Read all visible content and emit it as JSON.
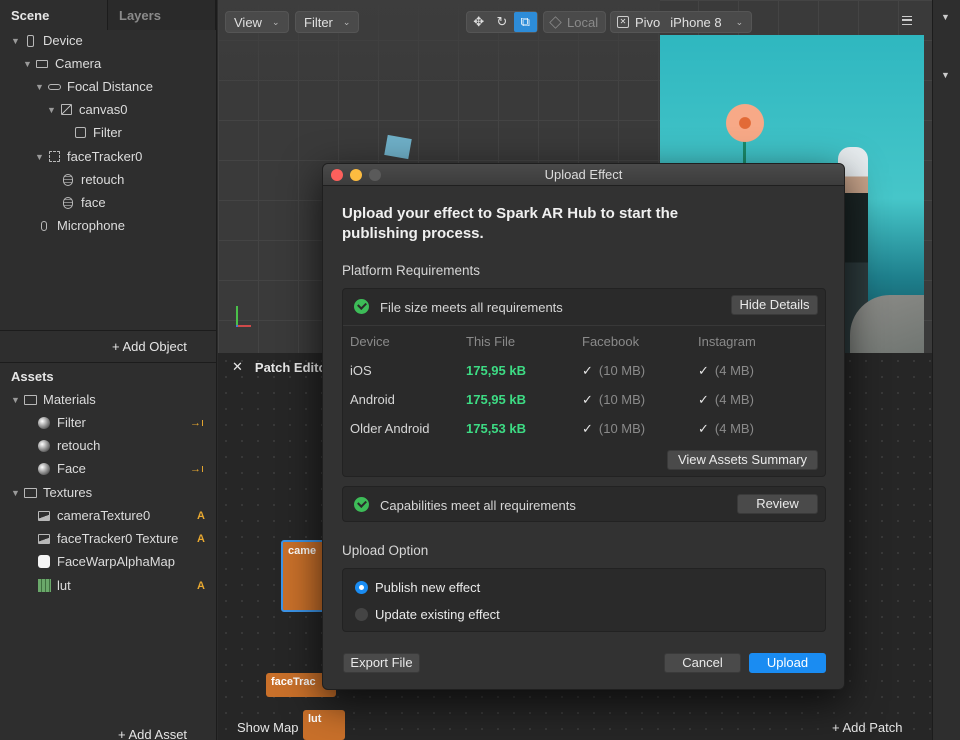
{
  "left_panel": {
    "tabs": [
      "Scene",
      "Layers"
    ],
    "scene_tree": {
      "device": "Device",
      "camera": "Camera",
      "focal_distance": "Focal Distance",
      "canvas": "canvas0",
      "filter": "Filter",
      "face_tracker": "faceTracker0",
      "retouch": "retouch",
      "face": "face",
      "microphone": "Microphone"
    },
    "add_object": "Add Object",
    "assets_title": "Assets",
    "materials_folder": "Materials",
    "materials": [
      "Filter",
      "retouch",
      "Face"
    ],
    "textures_folder": "Textures",
    "textures": [
      "cameraTexture0",
      "faceTracker0 Texture",
      "FaceWarpAlphaMap",
      "lut"
    ],
    "badge_a": "A",
    "add_asset": "Add Asset"
  },
  "viewport": {
    "view_label": "View",
    "filter_label": "Filter",
    "local_label": "Local",
    "device_label": "Pivo",
    "device_model": "iPhone 8"
  },
  "patch_editor": {
    "title": "Patch Editor",
    "show_map": "Show Map",
    "add_patch": "Add Patch",
    "patches": {
      "camera": "came",
      "face_tracker": "faceTrac",
      "lut": "lut"
    }
  },
  "modal": {
    "window_title": "Upload Effect",
    "heading": "Upload your effect to Spark AR Hub to start the publishing process.",
    "platform_requirements": "Platform Requirements",
    "file_size_status": "File size meets all requirements",
    "hide_details": "Hide Details",
    "table": {
      "headers": [
        "Device",
        "This File",
        "Facebook",
        "Instagram"
      ],
      "rows": [
        {
          "device": "iOS",
          "size": "175,95 kB",
          "facebook": "(10 MB)",
          "instagram": "(4 MB)"
        },
        {
          "device": "Android",
          "size": "175,95 kB",
          "facebook": "(10 MB)",
          "instagram": "(4 MB)"
        },
        {
          "device": "Older Android",
          "size": "175,53 kB",
          "facebook": "(10 MB)",
          "instagram": "(4 MB)"
        }
      ]
    },
    "view_assets_summary": "View Assets Summary",
    "capabilities_status": "Capabilities meet all requirements",
    "review": "Review",
    "upload_option": "Upload Option",
    "options": [
      "Publish new effect",
      "Update existing effect"
    ],
    "export_file": "Export File",
    "cancel": "Cancel",
    "upload": "Upload"
  },
  "colors": {
    "accent_blue": "#1a8cf2",
    "success_green": "#3ddc84",
    "patch_orange": "#c9702a",
    "badge_orange": "#e8a830"
  }
}
